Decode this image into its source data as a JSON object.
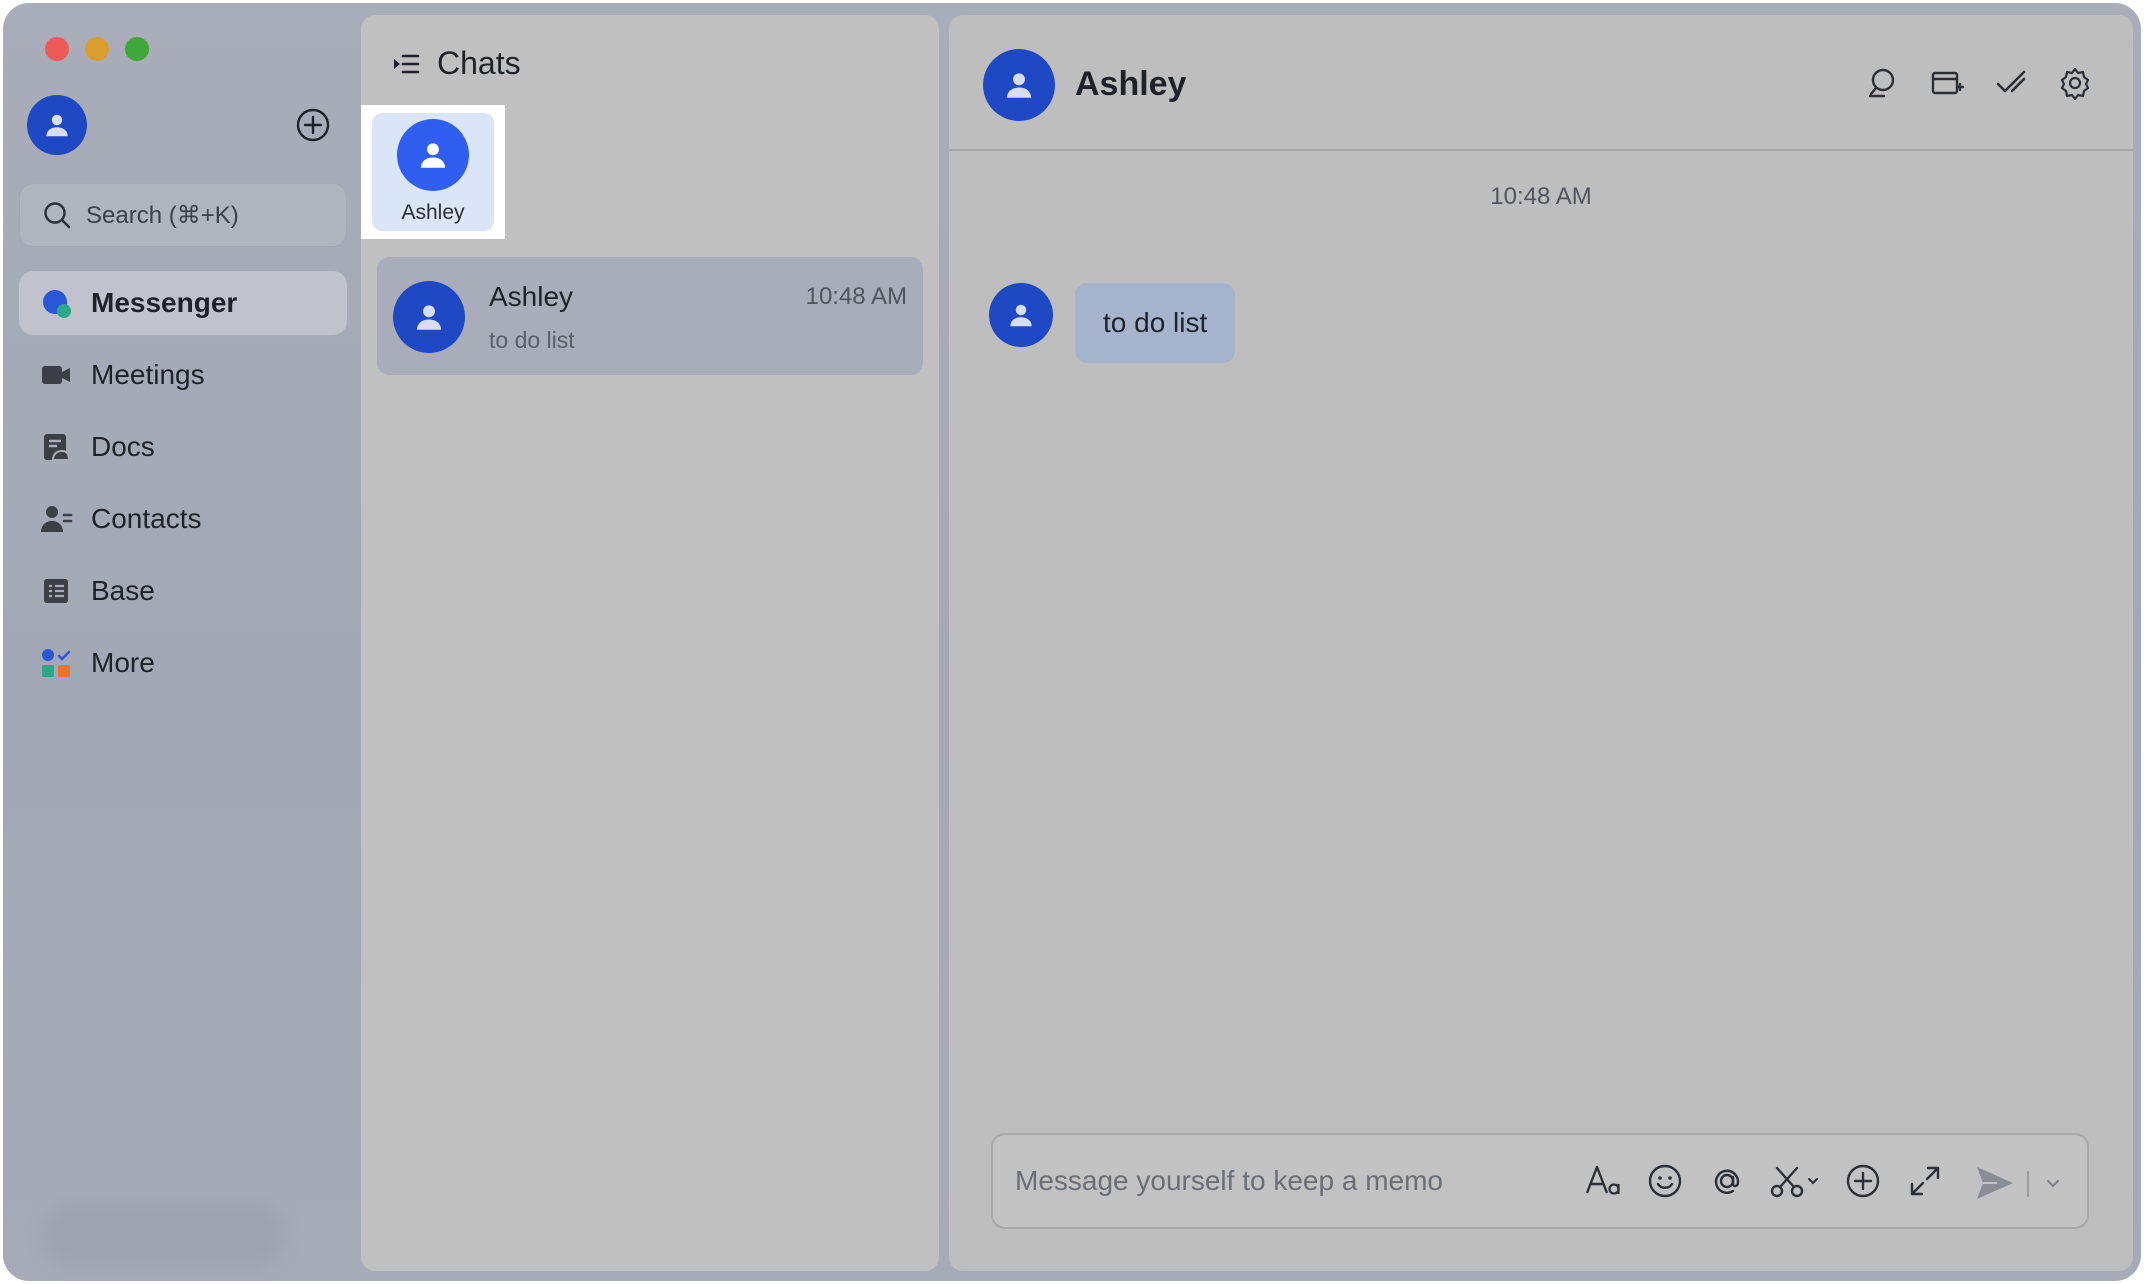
{
  "sidebar": {
    "search_placeholder": "Search (⌘+K)",
    "nav": [
      {
        "label": "Messenger",
        "icon": "messenger-icon",
        "active": true
      },
      {
        "label": "Meetings",
        "icon": "video-camera-icon"
      },
      {
        "label": "Docs",
        "icon": "docs-icon"
      },
      {
        "label": "Contacts",
        "icon": "contacts-icon"
      },
      {
        "label": "Base",
        "icon": "base-table-icon"
      },
      {
        "label": "More",
        "icon": "apps-grid-icon"
      }
    ]
  },
  "chatlist": {
    "title": "Chats",
    "pinned": [
      {
        "name": "Ashley"
      }
    ],
    "chats": [
      {
        "name": "Ashley",
        "time": "10:48 AM",
        "preview": "to do list"
      }
    ]
  },
  "conversation": {
    "contact_name": "Ashley",
    "header_tools": [
      "search-icon",
      "add-tab-icon",
      "checkmark-icon",
      "settings-icon"
    ],
    "messages": [
      {
        "time": "10:48 AM",
        "text": "to do list"
      }
    ],
    "composer": {
      "placeholder": "Message yourself to keep a memo",
      "tools": [
        "text-format-icon",
        "emoji-icon",
        "mention-icon",
        "screenshot-icon",
        "add-icon",
        "expand-icon",
        "send-icon"
      ]
    }
  },
  "colors": {
    "avatar": "#1f48c4",
    "pinned_avatar": "#2f5ef0",
    "bubble": "#a6b3cc",
    "traffic_red": "#ec5b56",
    "traffic_yellow": "#d99e2e",
    "traffic_green": "#3fa83a"
  }
}
